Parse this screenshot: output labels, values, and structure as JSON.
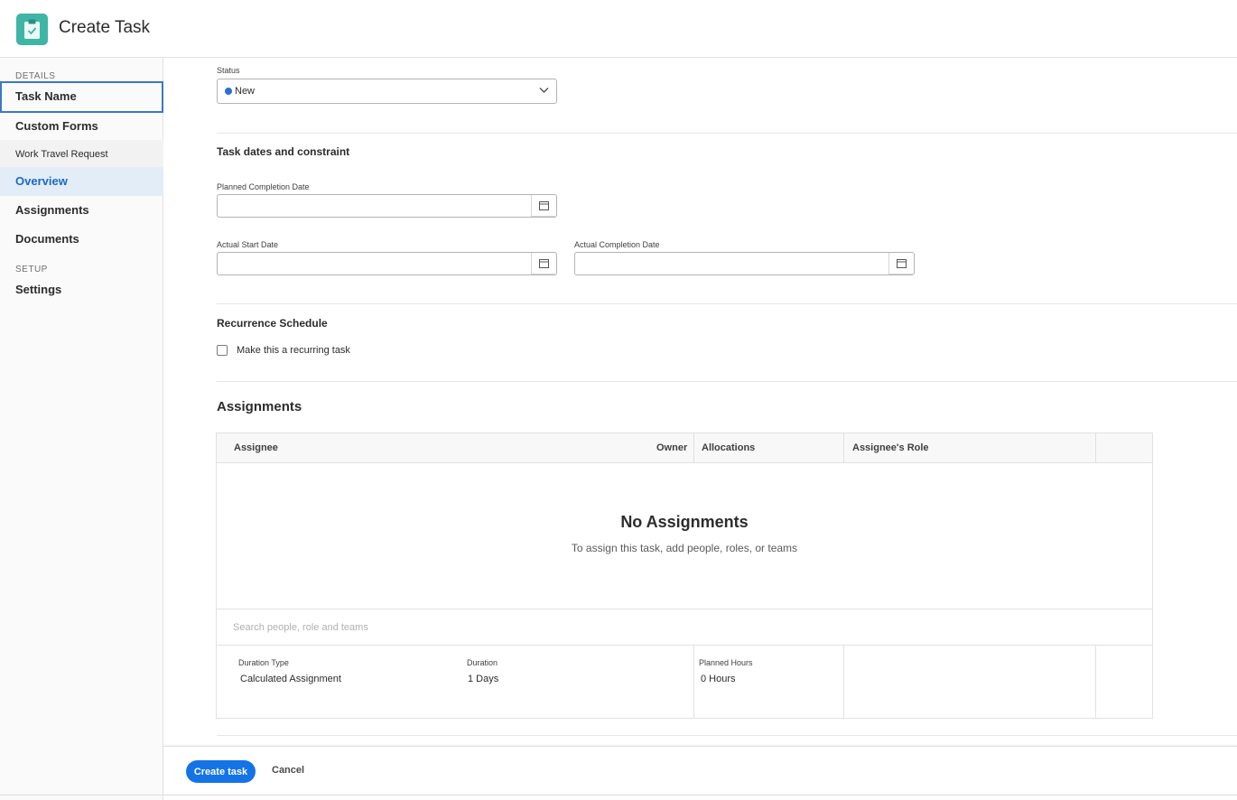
{
  "header": {
    "title": "Create Task",
    "icon": "clipboard-check-icon",
    "icon_color": "#3fb5a6"
  },
  "sidebar": {
    "details_label": "DETAILS",
    "setup_label": "SETUP",
    "items": [
      {
        "label": "Task Name"
      },
      {
        "label": "Custom Forms"
      },
      {
        "label": "Work Travel Request"
      },
      {
        "label": "Overview"
      },
      {
        "label": "Assignments"
      },
      {
        "label": "Documents"
      },
      {
        "label": "Settings"
      }
    ]
  },
  "status": {
    "label": "Status",
    "value": "New",
    "dot_color": "#2a6fd4"
  },
  "dates": {
    "title": "Task dates and constraint",
    "planned_completion_label": "Planned Completion Date",
    "actual_start_label": "Actual Start Date",
    "actual_completion_label": "Actual Completion Date"
  },
  "recurrence": {
    "title": "Recurrence Schedule",
    "checkbox_label": "Make this a recurring task",
    "checked": false
  },
  "assignments": {
    "title": "Assignments",
    "columns": {
      "assignee": "Assignee",
      "owner": "Owner",
      "allocations": "Allocations",
      "role": "Assignee's Role"
    },
    "empty_title": "No Assignments",
    "empty_subtitle": "To assign this task, add people, roles, or teams",
    "search_placeholder": "Search people, role and teams",
    "duration_type_label": "Duration Type",
    "duration_type_value": "Calculated Assignment",
    "duration_label": "Duration",
    "duration_value": "1 Days",
    "planned_hours_label": "Planned Hours",
    "planned_hours_value": "0 Hours"
  },
  "footer": {
    "create_label": "Create task",
    "cancel_label": "Cancel"
  },
  "colors": {
    "accent": "#1473e6",
    "active_nav_bg": "#e3edf8",
    "active_nav_text": "#1a68c9"
  }
}
